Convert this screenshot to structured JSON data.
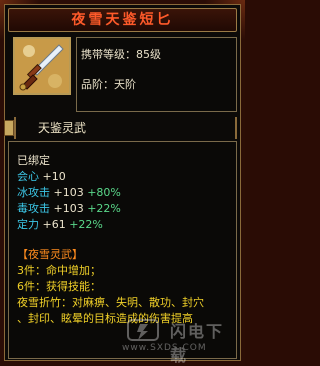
{
  "item": {
    "title": "夜雪天鉴短匕",
    "icon": "dagger-icon",
    "carry_level": "携带等级：85级",
    "grade": "品阶：天阶",
    "series": "天鉴灵武"
  },
  "stats": {
    "bound": "已绑定",
    "crit_label": "会心",
    "crit_value": "+10",
    "ice_label": "冰攻击",
    "ice_value": "+103",
    "ice_pct": "+80%",
    "poison_label": "毒攻击",
    "poison_value": "+103",
    "poison_pct": "+22%",
    "focus_label": "定力",
    "focus_value": "+61",
    "focus_pct": "+22%"
  },
  "set": {
    "name": "【夜雪灵武】",
    "piece3": "3件：命中增加；",
    "piece6": "6件：获得技能：",
    "skill_line1": "夜雪折竹：对麻痹、失明、散功、封穴",
    "skill_line2": "、封印、眩晕的目标造成的伤害提高"
  },
  "watermark": {
    "text": "www.SXDS.COM",
    "brand": "闪电下载"
  },
  "colors": {
    "title": "#ff5a2a",
    "stat_label": "#3cc8e8",
    "set_name": "#ff8c1e",
    "set_text": "#f0d028"
  }
}
